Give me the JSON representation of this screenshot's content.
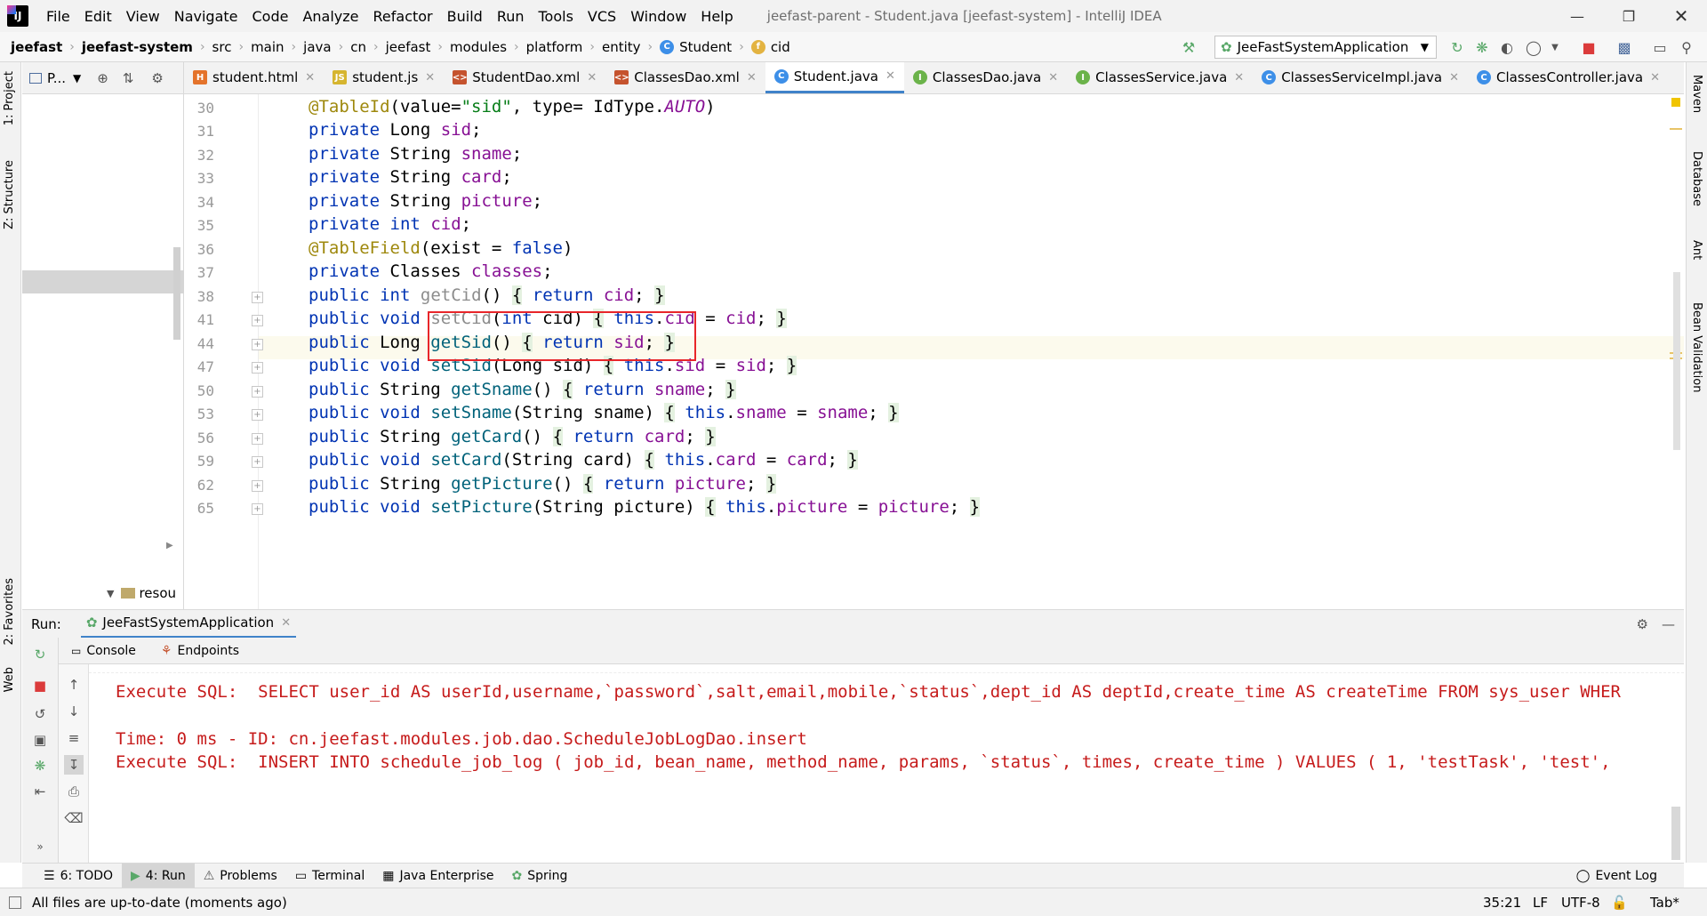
{
  "window": {
    "title": "jeefast-parent - Student.java [jeefast-system] - IntelliJ IDEA",
    "logo": "IJ"
  },
  "menu": [
    "File",
    "Edit",
    "View",
    "Navigate",
    "Code",
    "Analyze",
    "Refactor",
    "Build",
    "Run",
    "Tools",
    "VCS",
    "Window",
    "Help"
  ],
  "breadcrumbs": [
    "jeefast",
    "jeefast-system",
    "src",
    "main",
    "java",
    "cn",
    "jeefast",
    "modules",
    "platform",
    "entity",
    "Student",
    "cid"
  ],
  "run_config": "JeeFastSystemApplication",
  "project_panel": {
    "title": "P...",
    "tree_item": "resou"
  },
  "left_strip": [
    "1: Project",
    "Z: Structure",
    "2: Favorites",
    "Web"
  ],
  "right_strip": [
    "Maven",
    "Database",
    "Ant",
    "Bean Validation"
  ],
  "tabs": [
    {
      "label": "student.html",
      "icon": "html-icon"
    },
    {
      "label": "student.js",
      "icon": "js-icon"
    },
    {
      "label": "StudentDao.xml",
      "icon": "xml-icon"
    },
    {
      "label": "ClassesDao.xml",
      "icon": "xml-icon"
    },
    {
      "label": "Student.java",
      "icon": "class-icon",
      "active": true
    },
    {
      "label": "ClassesDao.java",
      "icon": "interface-icon"
    },
    {
      "label": "ClassesService.java",
      "icon": "interface-icon"
    },
    {
      "label": "ClassesServiceImpl.java",
      "icon": "class-icon"
    },
    {
      "label": "ClassesController.java",
      "icon": "class-icon"
    }
  ],
  "editor": {
    "line_numbers": [
      "30",
      "31",
      "32",
      "33",
      "34",
      "35",
      "36",
      "37",
      "38",
      "41",
      "44",
      "47",
      "50",
      "53",
      "56",
      "59",
      "62",
      "65"
    ],
    "code_lines": [
      "@TableId(value=\"sid\", type= IdType.AUTO)",
      "private Long sid;",
      "private String sname;",
      "private String card;",
      "private String picture;",
      "private int cid;",
      "@TableField(exist = false)",
      "private Classes classes;",
      "public int getCid() { return cid; }",
      "public void setCid(int cid) { this.cid = cid; }",
      "public Long getSid() { return sid; }",
      "public void setSid(Long sid) { this.sid = sid; }",
      "public String getSname() { return sname; }",
      "public void setSname(String sname) { this.sname = sname; }",
      "public String getCard() { return card; }",
      "public void setCard(String card) { this.card = card; }",
      "public String getPicture() { return picture; }",
      "public void setPicture(String picture) { this.picture = picture; }"
    ]
  },
  "run_panel": {
    "label": "Run:",
    "config_tab": "JeeFastSystemApplication",
    "subtabs": [
      "Console",
      "Endpoints"
    ],
    "console_lines": [
      "Execute SQL:  SELECT user_id AS userId,username,`password`,salt,email,mobile,`status`,dept_id AS deptId,create_time AS createTime FROM sys_user WHER",
      "",
      "Time: 0 ms - ID: cn.jeefast.modules.job.dao.ScheduleJobLogDao.insert",
      "Execute SQL:  INSERT INTO schedule_job_log ( job_id, bean_name, method_name, params, `status`, times, create_time ) VALUES ( 1, 'testTask', 'test',"
    ]
  },
  "bottom_tabs": [
    "6: TODO",
    "4: Run",
    "Problems",
    "Terminal",
    "Java Enterprise",
    "Spring"
  ],
  "event_log": "Event Log",
  "status": {
    "message": "All files are up-to-date (moments ago)",
    "position": "35:21",
    "line_sep": "LF",
    "encoding": "UTF-8",
    "indent": "Tab*"
  },
  "colors": {
    "keyword": "#0033b3",
    "field": "#871094",
    "string": "#067d17",
    "annotation": "#9e880d",
    "console_error": "#c61b1b",
    "highlight_box": "#e8262a"
  }
}
